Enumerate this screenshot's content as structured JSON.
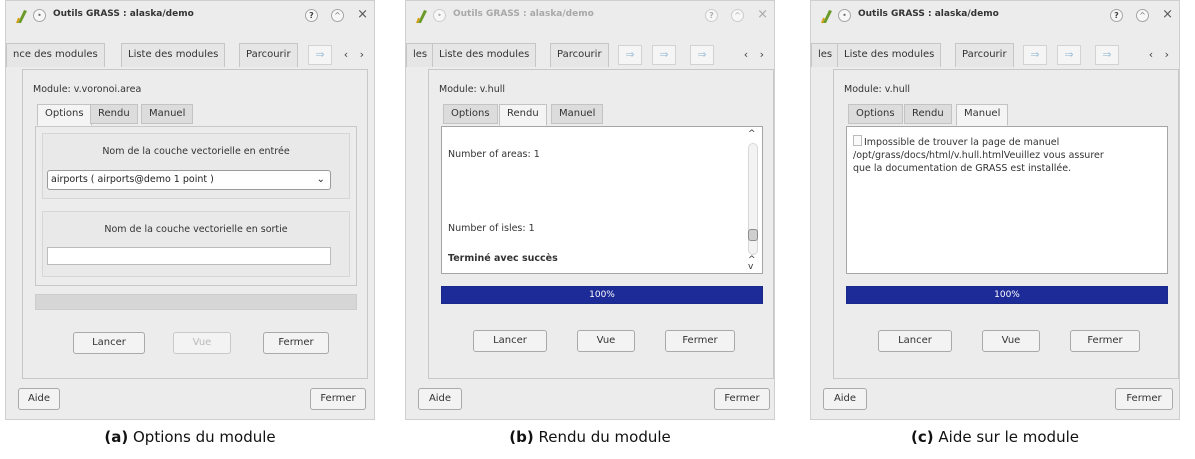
{
  "window_title": "Outils GRASS : alaska/demo",
  "title_buttons": {
    "help": "?",
    "up": "^",
    "close": "×"
  },
  "scroll_arrows": "‹ ›",
  "arrow_glyph": "⇒",
  "panels": [
    {
      "module_tabs": [
        "nce des modules",
        "Liste des modules",
        "Parcourir"
      ],
      "module_label": "Module: v.voronoi.area",
      "inner_tabs": [
        "Options",
        "Rendu",
        "Manuel"
      ],
      "active_inner_tab": "Options",
      "input_group_title": "Nom de la couche vectorielle en entrée",
      "input_value": "airports ( airports@demo 1 point )",
      "output_group_title": "Nom de la couche vectorielle en sortie",
      "output_value": "",
      "buttons": [
        "Lancer",
        "Vue",
        "Fermer"
      ],
      "disabled_buttons": [
        "Vue"
      ],
      "bottom_left": "Aide",
      "bottom_right": "Fermer",
      "caption_prefix": "(a)",
      "caption": "Options du module"
    },
    {
      "module_tabs": [
        "les",
        "Liste des modules",
        "Parcourir"
      ],
      "module_label": "Module: v.hull",
      "inner_tabs": [
        "Options",
        "Rendu",
        "Manuel"
      ],
      "active_inner_tab": "Rendu",
      "output_lines": [
        "Number of areas: 1",
        "Number of isles: 1",
        "Terminé avec succès"
      ],
      "progress_text": "100%",
      "progress_fraction": 1.0,
      "buttons": [
        "Lancer",
        "Vue",
        "Fermer"
      ],
      "bottom_left": "Aide",
      "bottom_right": "Fermer",
      "caption_prefix": "(b)",
      "caption": "Rendu du module"
    },
    {
      "module_tabs": [
        "les",
        "Liste des modules",
        "Parcourir"
      ],
      "module_label": "Module: v.hull",
      "inner_tabs": [
        "Options",
        "Rendu",
        "Manuel"
      ],
      "active_inner_tab": "Manuel",
      "help_lines": [
        "Impossible de trouver la page de manuel",
        "/opt/grass/docs/html/v.hull.htmlVeuillez vous assurer",
        "que la documentation de GRASS est installée."
      ],
      "progress_text": "100%",
      "progress_fraction": 1.0,
      "buttons": [
        "Lancer",
        "Vue",
        "Fermer"
      ],
      "bottom_left": "Aide",
      "bottom_right": "Fermer",
      "caption_prefix": "(c)",
      "caption": "Aide sur le module"
    }
  ],
  "colors": {
    "progress_fill": "#1d2b99",
    "window_bg": "#ececec"
  }
}
